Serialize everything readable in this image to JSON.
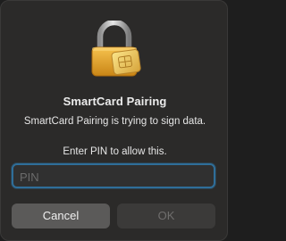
{
  "dialog": {
    "title": "SmartCard Pairing",
    "message": "SmartCard Pairing is trying to sign data.",
    "prompt": "Enter PIN to allow this.",
    "pin_field": {
      "placeholder": "PIN",
      "value": ""
    },
    "buttons": {
      "cancel_label": "Cancel",
      "ok_label": "OK"
    },
    "icon": "lock-with-smartcard-icon"
  },
  "colors": {
    "dialog_background": "#2b2a29",
    "focus_ring": "#2f6e99",
    "cancel_button": "#5b5a59",
    "ok_button_disabled": "#3b3a39",
    "lock_gold": "#e0a536"
  }
}
